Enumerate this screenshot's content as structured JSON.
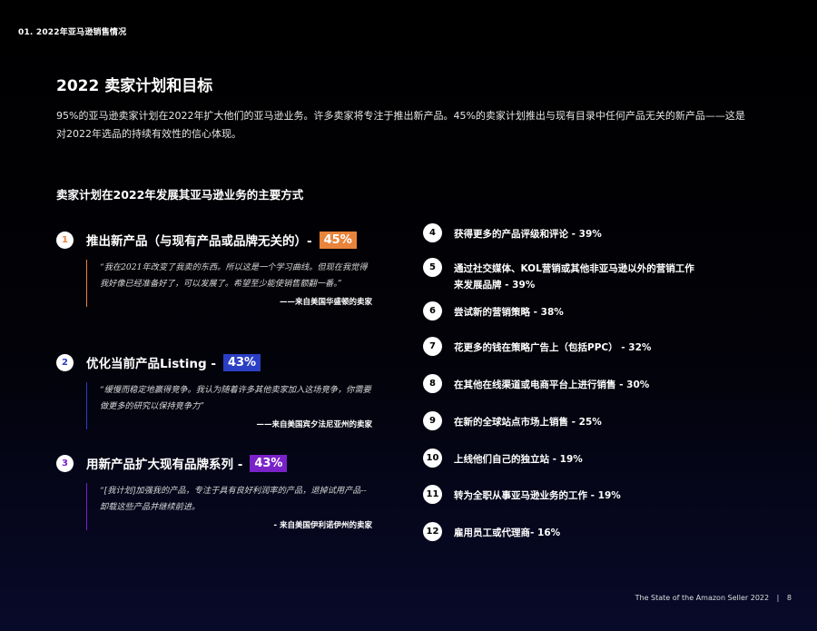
{
  "header": {
    "section_label": "01. 2022年亚马逊销售情况"
  },
  "title": "2022 卖家计划和目标",
  "intro": "95%的亚马逊卖家计划在2022年扩大他们的亚马逊业务。许多卖家将专注于推出新产品。45%的卖家计划推出与现有目录中任何产品无关的新产品——这是对2022年选品的持续有效性的信心体现。",
  "subhead": "卖家计划在2022年发展其亚马逊业务的主要方式",
  "featured": [
    {
      "number": "1",
      "text": "推出新产品（与现有产品或品牌无关的）-",
      "percent": "45%",
      "color": "#e8843b",
      "quote": "“我在2021年改变了我卖的东西。所以这是一个学习曲线。但现在我觉得我好像已经准备好了，可以发展了。希望至少能使销售额翻一番。”",
      "attribution": "——来自美国华盛顿的卖家"
    },
    {
      "number": "2",
      "text": "优化当前产品Listing -",
      "percent": "43%",
      "color": "#2a3fc4",
      "quote": "“缓慢而稳定地赢得竞争。我认为随着许多其他卖家加入这场竞争，你需要做更多的研究以保持竞争力”",
      "attribution": "——来自美国宾夕法尼亚州的卖家"
    },
    {
      "number": "3",
      "text": "用新产品扩大现有品牌系列 -",
      "percent": "43%",
      "color": "#7a22c9",
      "quote": "“[我计划]加强我的产品，专注于具有良好利润率的产品，退掉试用产品--卸载这些产品并继续前进。",
      "attribution": "- 来自美国伊利诺伊州的卖家"
    }
  ],
  "list": [
    {
      "number": "4",
      "text": "获得更多的产品评级和评论 - 39%"
    },
    {
      "number": "5",
      "text": "通过社交媒体、KOL营销或其他非亚马逊以外的营销工作",
      "text2": "来发展品牌 - 39%"
    },
    {
      "number": "6",
      "text": "尝试新的营销策略 - 38%"
    },
    {
      "number": "7",
      "text": "花更多的钱在策略广告上（包括PPC） - 32%"
    },
    {
      "number": "8",
      "text": "在其他在线渠道或电商平台上进行销售 - 30%"
    },
    {
      "number": "9",
      "text": "在新的全球站点市场上销售 - 25%"
    },
    {
      "number": "10",
      "text": "上线他们自己的独立站 - 19%"
    },
    {
      "number": "11",
      "text": "转为全职从事亚马逊业务的工作 - 19%"
    },
    {
      "number": "12",
      "text": "雇用员工或代理商- 16%"
    }
  ],
  "footer": {
    "report": "The State of the Amazon Seller 2022",
    "separator": "|",
    "page": "8"
  }
}
